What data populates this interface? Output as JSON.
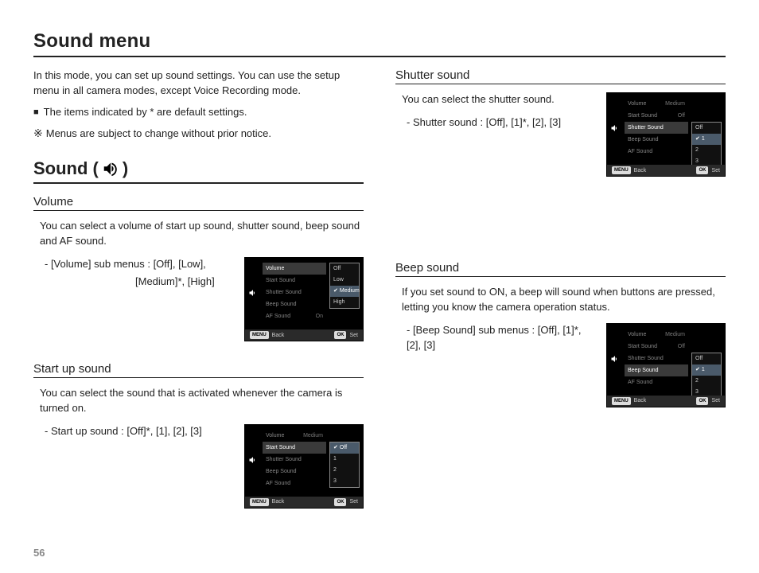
{
  "page_title": "Sound menu",
  "intro": {
    "p1": "In this mode, you can set up sound settings. You can use the setup menu in all camera modes, except Voice Recording mode.",
    "bullet": "The items indicated by * are default settings.",
    "note": "Menus are subject to change without prior notice."
  },
  "section_sound": {
    "title_prefix": "Sound (",
    "title_suffix": " )"
  },
  "volume": {
    "heading": "Volume",
    "body": "You can select a volume of start up sound, shutter sound, beep sound and AF sound.",
    "detail1": "- [Volume] sub menus : [Off], [Low],",
    "detail2": "[Medium]*, [High]"
  },
  "startup": {
    "heading": "Start up sound",
    "body": "You can select the sound that is activated whenever the camera is turned on.",
    "detail": "- Start up sound : [Off]*, [1], [2], [3]"
  },
  "shutter": {
    "heading": "Shutter sound",
    "body": "You can select the shutter sound.",
    "detail": "- Shutter sound : [Off], [1]*, [2], [3]"
  },
  "beep": {
    "heading": "Beep sound",
    "body": "If you set sound to ON, a beep will sound when buttons are pressed, letting you know the camera operation status.",
    "detail": "- [Beep Sound] sub menus : [Off], [1]*, [2], [3]"
  },
  "menu_labels": {
    "volume": "Volume",
    "start_sound": "Start Sound",
    "shutter_sound": "Shutter Sound",
    "beep_sound": "Beep Sound",
    "af_sound": "AF Sound",
    "back_btn": "MENU",
    "back": "Back",
    "set_btn": "OK",
    "set": "Set",
    "val_medium": "Medium",
    "val_off": "Off",
    "val_on": "On"
  },
  "menu_volume_options": {
    "o1": "Off",
    "o2": "Low",
    "o3": "Medium",
    "o4": "High"
  },
  "menu_0123_options": {
    "o1": "Off",
    "o2": "1",
    "o3": "2",
    "o4": "3"
  },
  "page_number": "56",
  "note_symbol": "※"
}
